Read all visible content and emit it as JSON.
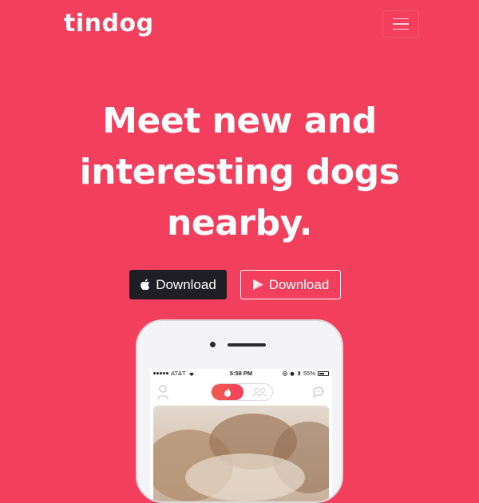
{
  "navbar": {
    "brand": "tindog"
  },
  "hero": {
    "headline_lines": [
      "Meet new and",
      "interesting dogs",
      "nearby."
    ],
    "buttons": [
      {
        "label": "Download",
        "icon": "apple-icon",
        "style": "dark"
      },
      {
        "label": "Download",
        "icon": "google-play-icon",
        "style": "outline"
      }
    ]
  },
  "phone": {
    "status": {
      "carrier": "AT&T",
      "time": "5:58 PM",
      "battery": "55%"
    }
  },
  "colors": {
    "background": "#f23f5e",
    "dark_button": "#1f1e24",
    "text": "#ffffff"
  }
}
